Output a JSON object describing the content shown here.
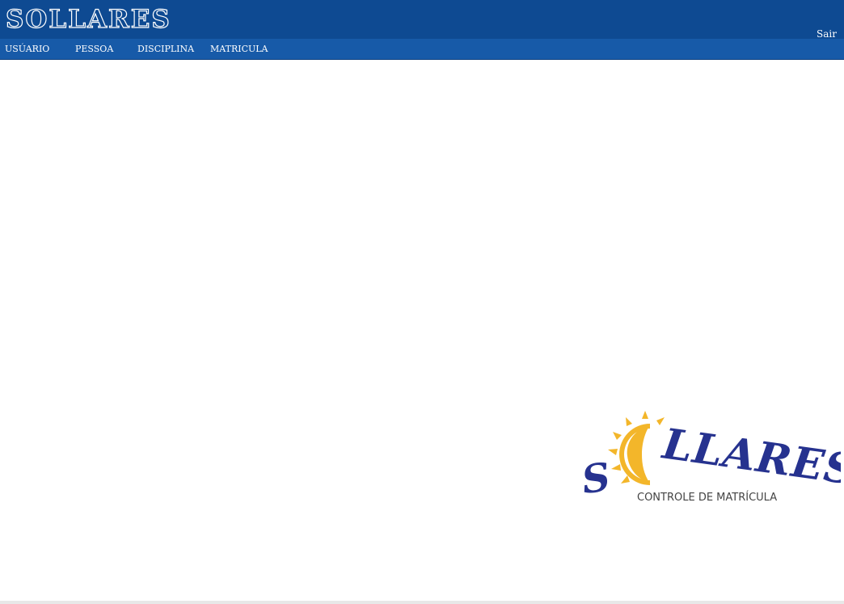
{
  "header": {
    "brand": "SOLLARES",
    "logout_label": "Sair"
  },
  "nav": {
    "items": [
      {
        "label": "USÚARIO"
      },
      {
        "label": "PESSOA"
      },
      {
        "label": "DISCIPLINA"
      },
      {
        "label": "MATRICULA"
      }
    ]
  },
  "logo": {
    "subtitle": "CONTROLE DE MATRÍCULA",
    "colors": {
      "text": "#26328f",
      "sun": "#f3b62a"
    }
  },
  "colors": {
    "topbar": "#0e4a92",
    "navbar": "#175aa8"
  }
}
